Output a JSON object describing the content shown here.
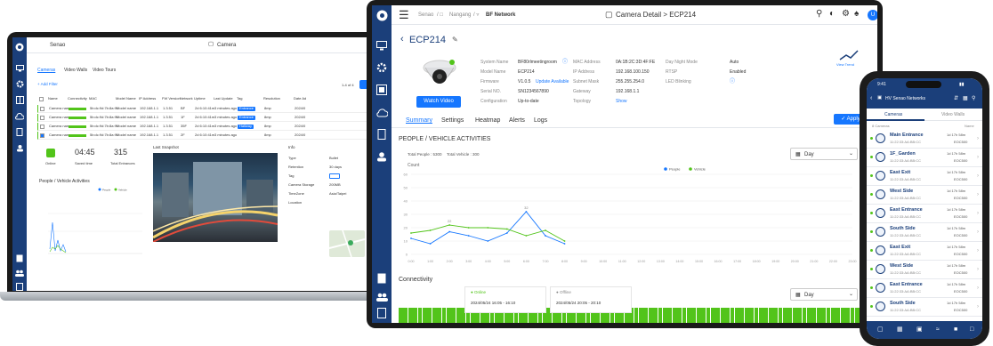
{
  "laptop": {
    "header": {
      "brand": "Senao",
      "title": "Camera"
    },
    "tabs": [
      "Cameras",
      "Video Walls",
      "Video Tours"
    ],
    "add_filter": "+ Add Filter",
    "pagination": "1-4 of 4",
    "columns": [
      "Name",
      "Connectivity",
      "MAC",
      "Model Name",
      "IP Address",
      "FW Version",
      "Network",
      "Uptime",
      "Last Update",
      "Tag",
      "Resolution",
      "Date Ad"
    ],
    "rows": [
      {
        "name": "Camera name",
        "mac": "5b:dc:9d:7b:8a:9f",
        "model": "Model name",
        "ip": "192.168.1.1",
        "fw": "1.3.51",
        "net": "BF",
        "uptime": "2d 6:10:41m",
        "last": "3 minutes ago",
        "tag": "Entrance",
        "res": "8mp",
        "date": "2024/0"
      },
      {
        "name": "Camera name",
        "mac": "5b:dc:9d:7b:8a:9f",
        "model": "Model name",
        "ip": "192.168.1.1",
        "fw": "1.3.51",
        "net": "1F",
        "uptime": "2d 6:10:41m",
        "last": "3 minutes ago",
        "tag": "Entrance",
        "res": "8mp",
        "date": "2024/0"
      },
      {
        "name": "Camera name",
        "mac": "5b:dc:9d:7b:8a:9f",
        "model": "Model name",
        "ip": "192.168.1.1",
        "fw": "1.3.51",
        "net": "35F",
        "uptime": "2d 6:10:41m",
        "last": "3 minutes ago",
        "tag": "Hallway",
        "res": "8mp",
        "date": "2024/0"
      },
      {
        "name": "Camera name",
        "mac": "5b:dc:9d:7b:8a:9f",
        "model": "Model name",
        "ip": "192.168.1.1",
        "fw": "1.3.51",
        "net": "2F",
        "uptime": "2d 6:10:41m",
        "last": "3 minutes ago",
        "tag": "",
        "res": "8mp",
        "date": "2024/0"
      }
    ],
    "stats": {
      "online_label": "Online",
      "time": "04:45",
      "time_label": "Saved time",
      "count": "315",
      "count_label": "Total Entrances"
    },
    "snapshot_label": "Last Snapshot",
    "activity_label": "People / Vehicle Activities",
    "legend": [
      "People",
      "Vehicle"
    ],
    "info": {
      "title": "Info",
      "rows": [
        [
          "Type",
          "Bullet"
        ],
        [
          "Retention",
          "30 days"
        ],
        [
          "Tag",
          ""
        ],
        [
          "Camera Storage",
          "200MB"
        ],
        [
          "TimeZone",
          "Asia/Taipei"
        ],
        [
          "Location",
          ""
        ]
      ]
    }
  },
  "center": {
    "breadcrumb": [
      "Senao",
      "Nangang",
      "BF Network"
    ],
    "title": "Camera Detail > ECP214",
    "avatar": "U",
    "device_name": "ECP214",
    "watch_video": "Watch Video",
    "details_left": [
      [
        "System Name",
        "BF80rlmeetingroom"
      ],
      [
        "Model Name",
        "ECP214"
      ],
      [
        "Firmware",
        "V1.0.5"
      ],
      [
        "Serial NO.",
        "SN1234567890"
      ],
      [
        "Configuration",
        "Up-to-date"
      ]
    ],
    "update_link": "Update Available",
    "details_mid": [
      [
        "MAC Address",
        "0A:1B:2C:3D:4F:FE"
      ],
      [
        "IP Address",
        "192.168.100.150"
      ],
      [
        "Subnet Mask",
        "255.255.254.0"
      ],
      [
        "Gateway",
        "192.168.1.1"
      ],
      [
        "Topology",
        "Show"
      ]
    ],
    "details_right": [
      [
        "Day Night Mode",
        "Auto"
      ],
      [
        "RTSP",
        "Enabled"
      ],
      [
        "LED Blinking",
        ""
      ]
    ],
    "view_trend": "View Trend",
    "tabs": [
      "Summary",
      "Settings",
      "Heatmap",
      "Alerts",
      "Logs"
    ],
    "apply": "Apply",
    "section_title": "PEOPLE / VEHICLE ACTIVITIES",
    "total_people": "Total People : 5300",
    "total_vehicle": "Total Vehicle : 300",
    "period": "Day",
    "count_label": "Count",
    "connectivity": "Connectivity",
    "conn_period": "Day",
    "online_label": "Online",
    "online_range": "2024/05/24 16:05 - 16:10",
    "offline_label": "Offline",
    "offline_range": "2024/05/24 20:05 - 20:10"
  },
  "phone": {
    "time": "9:41",
    "title": "HV Senao Networks",
    "tabs": [
      "Cameras",
      "Video Walls"
    ],
    "count": "8 Cameras",
    "sort": "Name",
    "items": [
      {
        "name": "Main Entrance",
        "mac": "11:22:33:AA:BB:CC",
        "uptime": "1d 17h 58m",
        "model": "EOC500"
      },
      {
        "name": "1F_Garden",
        "mac": "11:22:33:AA:BB:CC",
        "uptime": "1d 17h 58m",
        "model": "EOC500"
      },
      {
        "name": "East Exit",
        "mac": "11:22:33:AA:BB:CC",
        "uptime": "1d 17h 58m",
        "model": "EOC500"
      },
      {
        "name": "West Side",
        "mac": "11:22:33:AA:BB:CC",
        "uptime": "1d 17h 58m",
        "model": "EOC500"
      },
      {
        "name": "East Entrance",
        "mac": "11:22:33:AA:BB:CC",
        "uptime": "1d 17h 58m",
        "model": "EOC500"
      },
      {
        "name": "South Side",
        "mac": "11:22:33:AA:BB:CC",
        "uptime": "1d 17h 58m",
        "model": "EOC500"
      },
      {
        "name": "East Exit",
        "mac": "11:22:33:AA:BB:CC",
        "uptime": "1d 17h 58m",
        "model": "EOC500"
      },
      {
        "name": "West Side",
        "mac": "11:22:33:AA:BB:CC",
        "uptime": "1d 17h 58m",
        "model": "EOC500"
      },
      {
        "name": "East Entrance",
        "mac": "11:22:33:AA:BB:CC",
        "uptime": "1d 17h 58m",
        "model": "EOC500"
      },
      {
        "name": "South Side",
        "mac": "11:22:33:AA:BB:CC",
        "uptime": "1d 17h 58m",
        "model": "EOC500"
      }
    ]
  },
  "colors": {
    "sidebar": "#1b3f7a",
    "accent": "#1677ff",
    "people": "#1677ff",
    "vehicle": "#52c41a",
    "online": "#52c41a",
    "phone_header": "#1b3f7a"
  },
  "chart_data": {
    "type": "line",
    "categories": [
      "0:00",
      "1:00",
      "2:00",
      "3:00",
      "4:00",
      "5:00",
      "6:00",
      "7:00",
      "8:00",
      "9:00",
      "10:00",
      "11:00",
      "12:00",
      "13:00",
      "14:00",
      "15:00",
      "16:00",
      "17:00",
      "18:00",
      "19:00",
      "20:00",
      "21:00",
      "22:00",
      "23:00"
    ],
    "series": [
      {
        "name": "People",
        "values": [
          12,
          8,
          17,
          14,
          10,
          16,
          32,
          14,
          8,
          null,
          null,
          null,
          null,
          null,
          null,
          null,
          null,
          null,
          null,
          null,
          null,
          null,
          null,
          null
        ]
      },
      {
        "name": "Vehicle",
        "values": [
          16,
          18,
          22,
          20,
          20,
          19,
          14,
          18,
          10,
          null,
          null,
          null,
          null,
          null,
          null,
          null,
          null,
          null,
          null,
          null,
          null,
          null,
          null,
          null
        ]
      }
    ],
    "ylim": [
      0,
      60
    ],
    "yticks": [
      0,
      10,
      20,
      30,
      40,
      50,
      60
    ],
    "labels": [
      {
        "series": "Vehicle",
        "index": 2,
        "text": "22"
      },
      {
        "series": "People",
        "index": 6,
        "text": "32"
      }
    ]
  }
}
